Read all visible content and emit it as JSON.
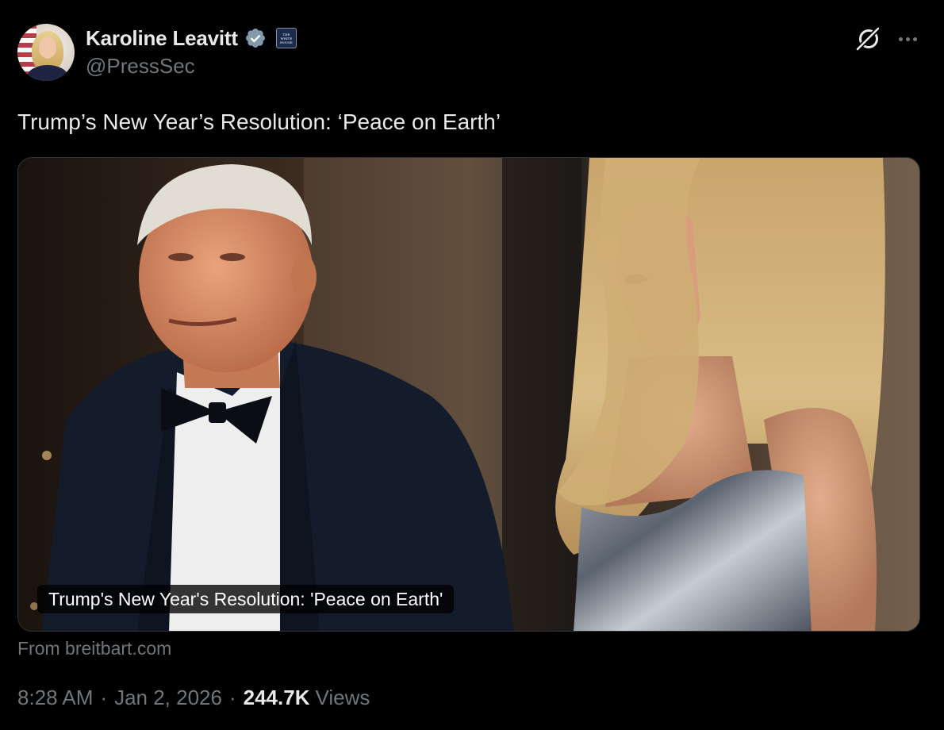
{
  "author": {
    "display_name": "Karoline Leavitt",
    "handle": "@PressSec",
    "verified_color": "#829aab",
    "affiliate_badge_text": "THE WHITE HOUSE"
  },
  "tweet": {
    "text": "Trump’s New Year’s Resolution: ‘Peace on Earth’"
  },
  "card": {
    "caption": "Trump's New Year's Resolution: 'Peace on Earth'",
    "source": "From breitbart.com"
  },
  "meta": {
    "time": "8:28 AM",
    "separator": "·",
    "date": "Jan 2, 2026",
    "views_count": "244.7K",
    "views_label": "Views"
  },
  "icons": {
    "grok": "grok-icon",
    "more": "more-icon",
    "verified": "verified-badge-icon"
  },
  "colors": {
    "background": "#000000",
    "primary_text": "#e7e9ea",
    "secondary_text": "#71767b"
  }
}
